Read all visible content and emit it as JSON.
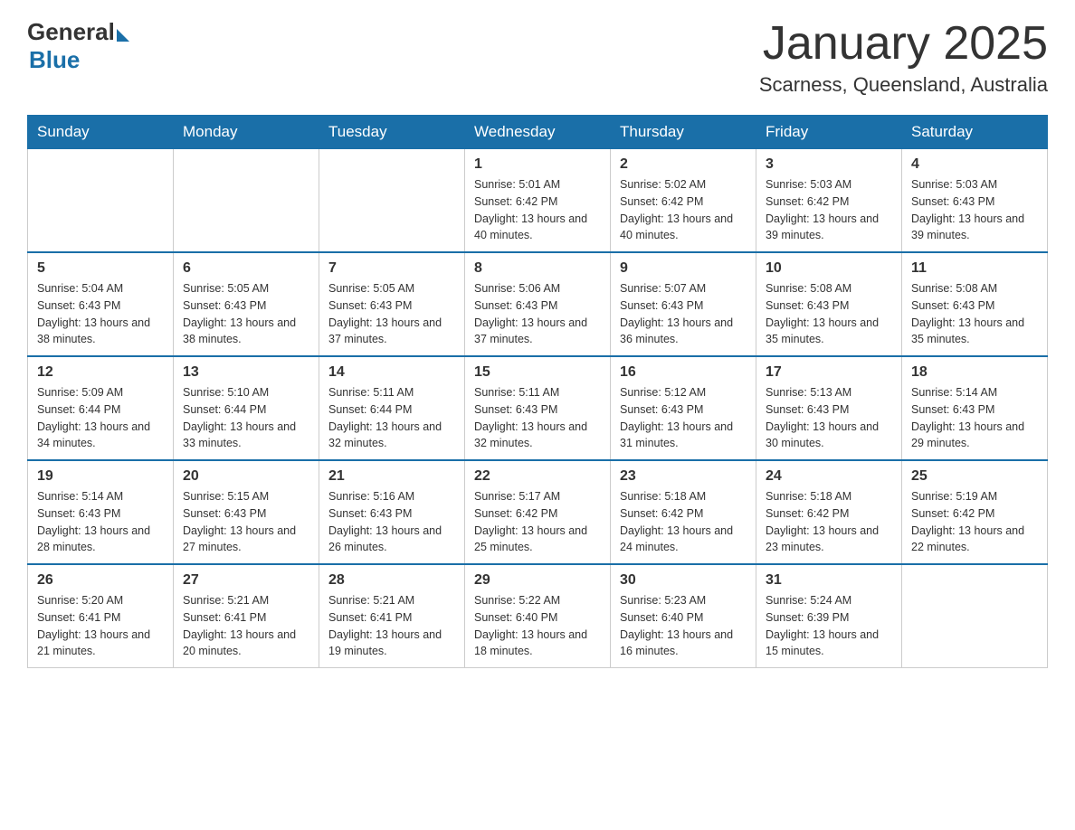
{
  "header": {
    "logo_general": "General",
    "logo_blue": "Blue",
    "month_title": "January 2025",
    "location": "Scarness, Queensland, Australia"
  },
  "days_of_week": [
    "Sunday",
    "Monday",
    "Tuesday",
    "Wednesday",
    "Thursday",
    "Friday",
    "Saturday"
  ],
  "weeks": [
    [
      {
        "day": "",
        "info": ""
      },
      {
        "day": "",
        "info": ""
      },
      {
        "day": "",
        "info": ""
      },
      {
        "day": "1",
        "info": "Sunrise: 5:01 AM\nSunset: 6:42 PM\nDaylight: 13 hours and 40 minutes."
      },
      {
        "day": "2",
        "info": "Sunrise: 5:02 AM\nSunset: 6:42 PM\nDaylight: 13 hours and 40 minutes."
      },
      {
        "day": "3",
        "info": "Sunrise: 5:03 AM\nSunset: 6:42 PM\nDaylight: 13 hours and 39 minutes."
      },
      {
        "day": "4",
        "info": "Sunrise: 5:03 AM\nSunset: 6:43 PM\nDaylight: 13 hours and 39 minutes."
      }
    ],
    [
      {
        "day": "5",
        "info": "Sunrise: 5:04 AM\nSunset: 6:43 PM\nDaylight: 13 hours and 38 minutes."
      },
      {
        "day": "6",
        "info": "Sunrise: 5:05 AM\nSunset: 6:43 PM\nDaylight: 13 hours and 38 minutes."
      },
      {
        "day": "7",
        "info": "Sunrise: 5:05 AM\nSunset: 6:43 PM\nDaylight: 13 hours and 37 minutes."
      },
      {
        "day": "8",
        "info": "Sunrise: 5:06 AM\nSunset: 6:43 PM\nDaylight: 13 hours and 37 minutes."
      },
      {
        "day": "9",
        "info": "Sunrise: 5:07 AM\nSunset: 6:43 PM\nDaylight: 13 hours and 36 minutes."
      },
      {
        "day": "10",
        "info": "Sunrise: 5:08 AM\nSunset: 6:43 PM\nDaylight: 13 hours and 35 minutes."
      },
      {
        "day": "11",
        "info": "Sunrise: 5:08 AM\nSunset: 6:43 PM\nDaylight: 13 hours and 35 minutes."
      }
    ],
    [
      {
        "day": "12",
        "info": "Sunrise: 5:09 AM\nSunset: 6:44 PM\nDaylight: 13 hours and 34 minutes."
      },
      {
        "day": "13",
        "info": "Sunrise: 5:10 AM\nSunset: 6:44 PM\nDaylight: 13 hours and 33 minutes."
      },
      {
        "day": "14",
        "info": "Sunrise: 5:11 AM\nSunset: 6:44 PM\nDaylight: 13 hours and 32 minutes."
      },
      {
        "day": "15",
        "info": "Sunrise: 5:11 AM\nSunset: 6:43 PM\nDaylight: 13 hours and 32 minutes."
      },
      {
        "day": "16",
        "info": "Sunrise: 5:12 AM\nSunset: 6:43 PM\nDaylight: 13 hours and 31 minutes."
      },
      {
        "day": "17",
        "info": "Sunrise: 5:13 AM\nSunset: 6:43 PM\nDaylight: 13 hours and 30 minutes."
      },
      {
        "day": "18",
        "info": "Sunrise: 5:14 AM\nSunset: 6:43 PM\nDaylight: 13 hours and 29 minutes."
      }
    ],
    [
      {
        "day": "19",
        "info": "Sunrise: 5:14 AM\nSunset: 6:43 PM\nDaylight: 13 hours and 28 minutes."
      },
      {
        "day": "20",
        "info": "Sunrise: 5:15 AM\nSunset: 6:43 PM\nDaylight: 13 hours and 27 minutes."
      },
      {
        "day": "21",
        "info": "Sunrise: 5:16 AM\nSunset: 6:43 PM\nDaylight: 13 hours and 26 minutes."
      },
      {
        "day": "22",
        "info": "Sunrise: 5:17 AM\nSunset: 6:42 PM\nDaylight: 13 hours and 25 minutes."
      },
      {
        "day": "23",
        "info": "Sunrise: 5:18 AM\nSunset: 6:42 PM\nDaylight: 13 hours and 24 minutes."
      },
      {
        "day": "24",
        "info": "Sunrise: 5:18 AM\nSunset: 6:42 PM\nDaylight: 13 hours and 23 minutes."
      },
      {
        "day": "25",
        "info": "Sunrise: 5:19 AM\nSunset: 6:42 PM\nDaylight: 13 hours and 22 minutes."
      }
    ],
    [
      {
        "day": "26",
        "info": "Sunrise: 5:20 AM\nSunset: 6:41 PM\nDaylight: 13 hours and 21 minutes."
      },
      {
        "day": "27",
        "info": "Sunrise: 5:21 AM\nSunset: 6:41 PM\nDaylight: 13 hours and 20 minutes."
      },
      {
        "day": "28",
        "info": "Sunrise: 5:21 AM\nSunset: 6:41 PM\nDaylight: 13 hours and 19 minutes."
      },
      {
        "day": "29",
        "info": "Sunrise: 5:22 AM\nSunset: 6:40 PM\nDaylight: 13 hours and 18 minutes."
      },
      {
        "day": "30",
        "info": "Sunrise: 5:23 AM\nSunset: 6:40 PM\nDaylight: 13 hours and 16 minutes."
      },
      {
        "day": "31",
        "info": "Sunrise: 5:24 AM\nSunset: 6:39 PM\nDaylight: 13 hours and 15 minutes."
      },
      {
        "day": "",
        "info": ""
      }
    ]
  ]
}
